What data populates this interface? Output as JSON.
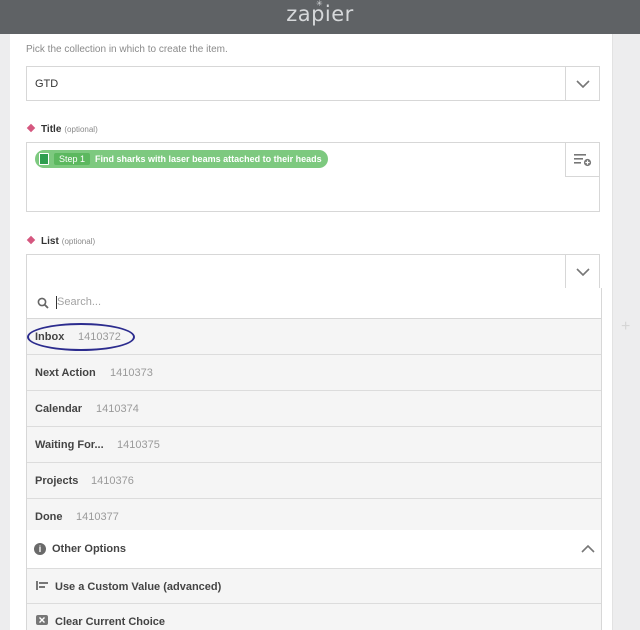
{
  "header": {
    "logo_text": "zapier"
  },
  "collection_field": {
    "help_text": "Pick the collection in which to create the item.",
    "value": "GTD"
  },
  "title_field": {
    "label": "Title",
    "optional": "(optional)",
    "pill": {
      "step": "Step 1",
      "text": "Find sharks with laser beams attached to their heads"
    }
  },
  "list_field": {
    "label": "List",
    "optional": "(optional)",
    "value": "",
    "search_placeholder": "Search...",
    "options": [
      {
        "label": "Inbox",
        "id": "1410372"
      },
      {
        "label": "Next Action",
        "id": "1410373"
      },
      {
        "label": "Calendar",
        "id": "1410374"
      },
      {
        "label": "Waiting For...",
        "id": "1410375"
      },
      {
        "label": "Projects",
        "id": "1410376"
      },
      {
        "label": "Done",
        "id": "1410377"
      }
    ],
    "other_options": {
      "label": "Other Options",
      "items": [
        {
          "label": "Use a Custom Value (advanced)",
          "icon": "custom-value-icon"
        },
        {
          "label": "Clear Current Choice",
          "icon": "clear-icon"
        }
      ]
    }
  },
  "colors": {
    "header": "#5f6265",
    "pill": "#7dc97f",
    "required_marker": "#d5577f",
    "annotation": "#2c2c8e"
  }
}
